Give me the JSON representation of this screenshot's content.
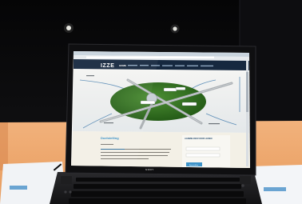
{
  "site": {
    "logo": "IZZE",
    "nav_home": "HOME",
    "heading": "Doelstelling",
    "sidebar_heading": "AANMELDEN VOOR LEDEN",
    "submit": "Aanmelden"
  },
  "laptop": {
    "brand": "SONY"
  },
  "colors": {
    "background": "#0c0c0e",
    "site_header": "#16283f",
    "ellipse": "#2c6e1c",
    "accent": "#3d93c9"
  }
}
